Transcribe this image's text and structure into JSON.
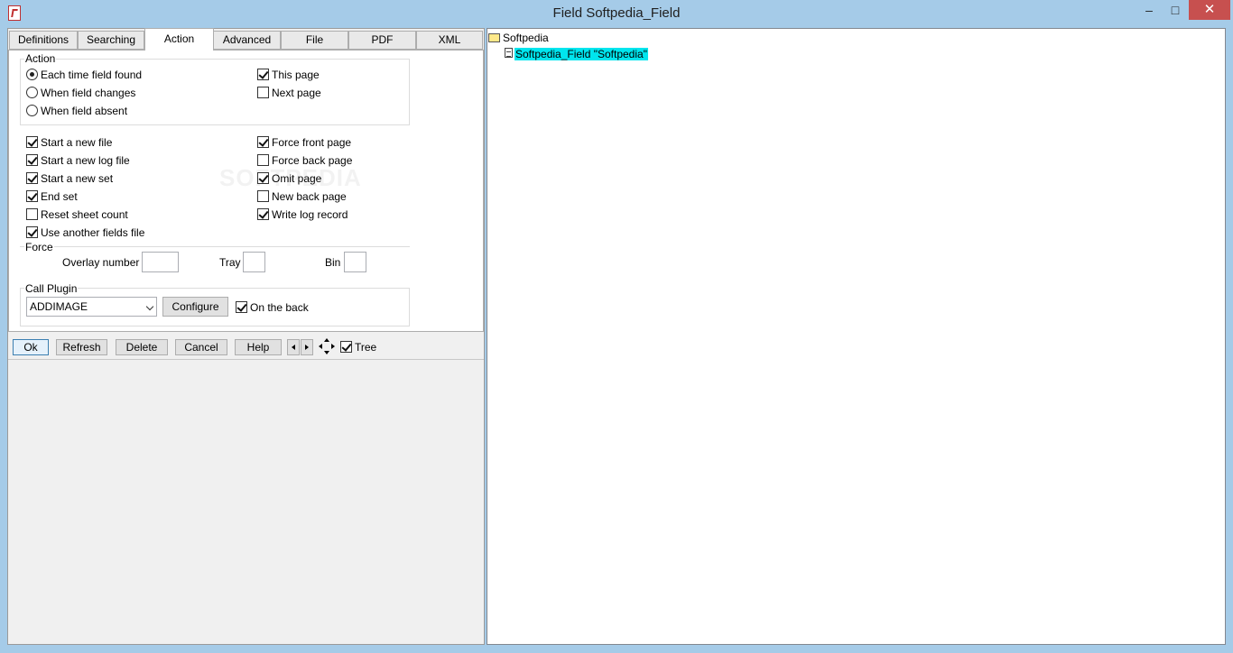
{
  "window": {
    "title": "Field Softpedia_Field",
    "app_icon": "pdf-app-icon",
    "min_glyph": "–",
    "max_glyph": "□",
    "close_glyph": "✕"
  },
  "tabs": [
    {
      "label": "Definitions"
    },
    {
      "label": "Searching"
    },
    {
      "label": "Action",
      "active": true
    },
    {
      "label": "Advanced"
    },
    {
      "label": "File"
    },
    {
      "label": "PDF"
    },
    {
      "label": "XML"
    }
  ],
  "action_group": {
    "title": "Action",
    "radios": [
      {
        "label": "Each time field found",
        "checked": true
      },
      {
        "label": "When field changes",
        "checked": false
      },
      {
        "label": "When field absent",
        "checked": false
      }
    ],
    "page_checks": [
      {
        "label": "This page",
        "checked": true
      },
      {
        "label": "Next page",
        "checked": false
      }
    ]
  },
  "options": {
    "left": [
      {
        "label": "Start a new file",
        "checked": true
      },
      {
        "label": "Start a new log file",
        "checked": true
      },
      {
        "label": "Start a new set",
        "checked": true
      },
      {
        "label": "End set",
        "checked": true
      },
      {
        "label": "Reset sheet count",
        "checked": false
      },
      {
        "label": "Use another fields file",
        "checked": true
      }
    ],
    "right": [
      {
        "label": "Force front page",
        "checked": true
      },
      {
        "label": "Force back page",
        "checked": false
      },
      {
        "label": "Omit page",
        "checked": true
      },
      {
        "label": "New back page",
        "checked": false
      },
      {
        "label": "Write log record",
        "checked": true
      }
    ]
  },
  "force_group": {
    "title": "Force",
    "overlay_label": "Overlay number",
    "overlay_value": "",
    "tray_label": "Tray",
    "tray_value": "",
    "bin_label": "Bin",
    "bin_value": ""
  },
  "plugin_group": {
    "title": "Call Plugin",
    "selected": "ADDIMAGE",
    "configure_label": "Configure",
    "on_back_label": "On the back",
    "on_back_checked": true
  },
  "buttons": {
    "ok": "Ok",
    "refresh": "Refresh",
    "delete": "Delete",
    "cancel": "Cancel",
    "help": "Help",
    "tree_label": "Tree",
    "tree_checked": true
  },
  "watermark": "SOFTPEDIA",
  "tree": {
    "root": "Softpedia",
    "child": "Softpedia_Field \"Softpedia\"",
    "child_color": "#00e5ee"
  }
}
